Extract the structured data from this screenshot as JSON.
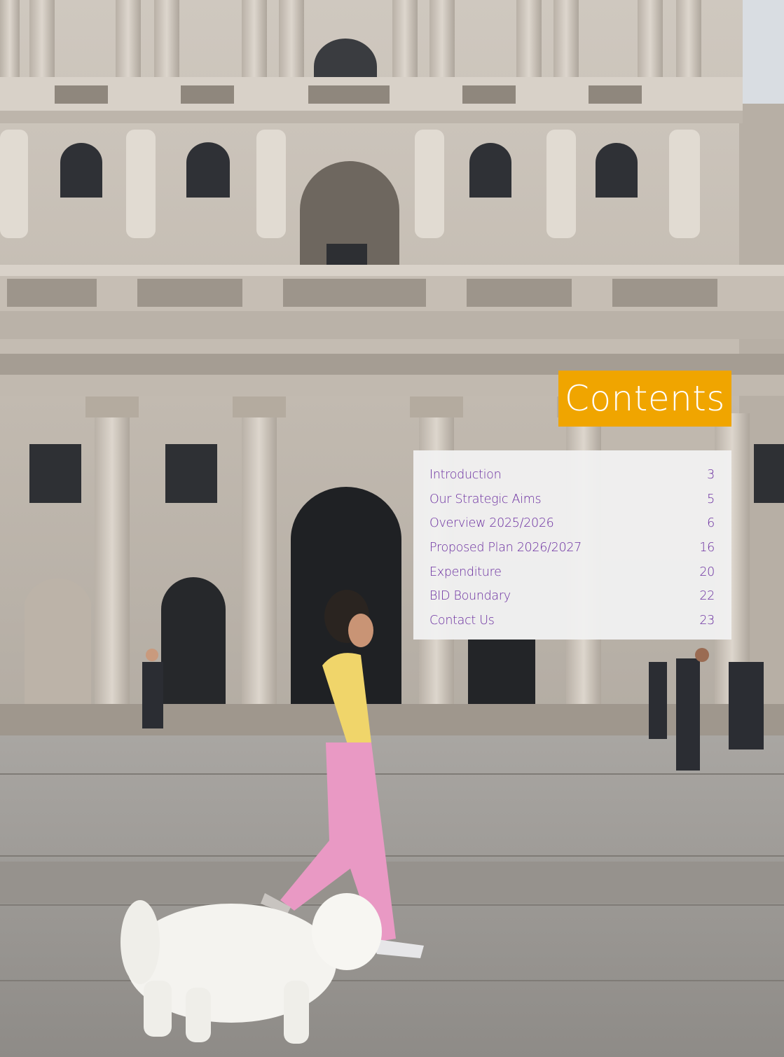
{
  "header": {
    "title": "Contents"
  },
  "toc": {
    "items": [
      {
        "label": "Introduction",
        "page": "3"
      },
      {
        "label": "Our Strategic Aims",
        "page": "5"
      },
      {
        "label": "Overview 2025/2026",
        "page": "6"
      },
      {
        "label": "Proposed Plan 2026/2027",
        "page": "16"
      },
      {
        "label": "Expenditure",
        "page": "20"
      },
      {
        "label": "BID Boundary",
        "page": "22"
      },
      {
        "label": "Contact Us",
        "page": "23"
      }
    ]
  },
  "colors": {
    "accent": "#f0a500",
    "link": "#6b2fa0",
    "panel": "#f0f0f0",
    "stone": "#cbc4bb"
  },
  "image": {
    "subject": "child-walking-dog-photo"
  }
}
